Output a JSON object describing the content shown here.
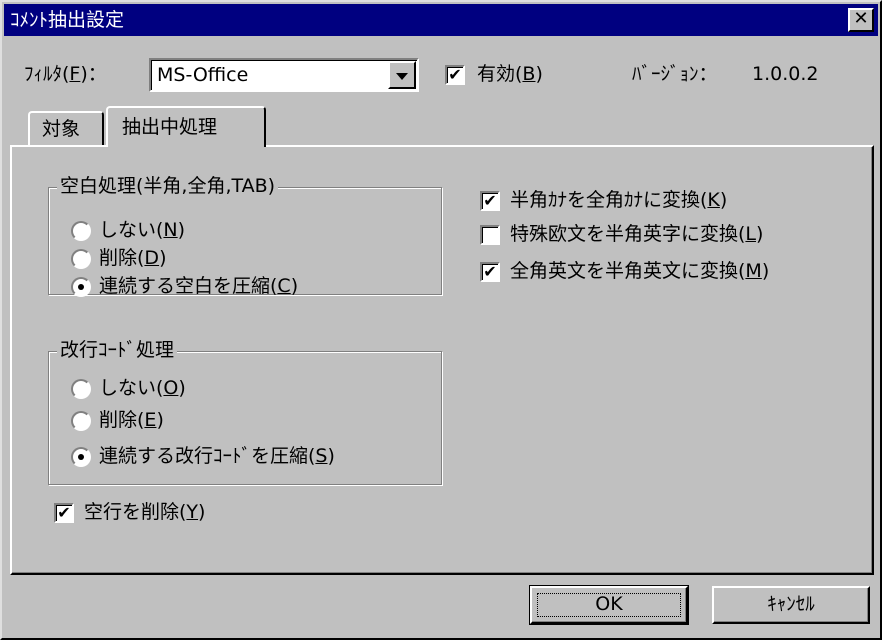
{
  "title": "ｺﾒﾝﾄ抽出設定",
  "close_glyph": "✕",
  "filter": {
    "label": "ﾌｨﾙﾀ(",
    "accel": "F",
    "suffix": ")：",
    "value": "MS-Office"
  },
  "enabled": {
    "label": "有効(",
    "accel": "B",
    "suffix": ")",
    "checked": true
  },
  "version": {
    "label": "ﾊﾞｰｼﾞｮﾝ：",
    "value": "1.0.0.2"
  },
  "tabs": [
    {
      "label": "対象",
      "active": false
    },
    {
      "label": "抽出中処理",
      "active": true
    }
  ],
  "whitespace_group": {
    "title": "空白処理(半角,全角,TAB)",
    "options": [
      {
        "label": "しない(",
        "accel": "N",
        "suffix": ")",
        "selected": false
      },
      {
        "label": "削除(",
        "accel": "D",
        "suffix": ")",
        "selected": false
      },
      {
        "label": "連続する空白を圧縮(",
        "accel": "C",
        "suffix": ")",
        "selected": true
      }
    ]
  },
  "newline_group": {
    "title": "改行ｺｰﾄﾞ処理",
    "options": [
      {
        "label": "しない(",
        "accel": "O",
        "suffix": ")",
        "selected": false
      },
      {
        "label": "削除(",
        "accel": "E",
        "suffix": ")",
        "selected": false
      },
      {
        "label": "連続する改行ｺｰﾄﾞを圧縮(",
        "accel": "S",
        "suffix": ")",
        "selected": true
      }
    ]
  },
  "delete_blank_lines": {
    "label": "空行を削除(",
    "accel": "Y",
    "suffix": ")",
    "checked": true
  },
  "conversions": [
    {
      "label": "半角ｶﾅを全角ｶﾅに変換(",
      "accel": "K",
      "suffix": ")",
      "checked": true
    },
    {
      "label": "特殊欧文を半角英字に変換(",
      "accel": "L",
      "suffix": ")",
      "checked": false
    },
    {
      "label": "全角英文を半角英文に変換(",
      "accel": "M",
      "suffix": ")",
      "checked": true
    }
  ],
  "check_glyph": "✔",
  "buttons": {
    "ok": "OK",
    "cancel": "ｷｬﾝｾﾙ"
  }
}
